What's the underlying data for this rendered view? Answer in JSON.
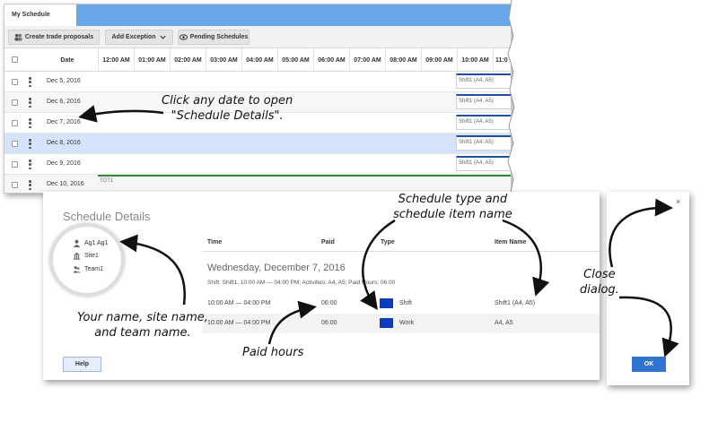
{
  "schedule": {
    "tab_label": "My Schedule",
    "toolbar": {
      "trade_label": "Create trade proposals",
      "exception_label": "Add Exception",
      "pending_label": "Pending Schedules"
    },
    "date_header": "Date",
    "hours": [
      "12:00 AM",
      "01:00 AM",
      "02:00 AM",
      "03:00 AM",
      "04:00 AM",
      "05:00 AM",
      "06:00 AM",
      "07:00 AM",
      "08:00 AM",
      "09:00 AM",
      "10:00 AM",
      "11:0"
    ],
    "rows": [
      {
        "date": "Dec 5, 2016",
        "shift": "Shift1 (A4, A5)"
      },
      {
        "date": "Dec 6, 2016",
        "shift": "Shift1 (A4, A5)"
      },
      {
        "date": "Dec 7, 2016",
        "shift": "Shift1 (A4, A5)"
      },
      {
        "date": "Dec 8, 2016",
        "shift": "Shift1 (A4, A5)"
      },
      {
        "date": "Dec 9, 2016",
        "shift": "Shift1 (A4, A5)"
      },
      {
        "date": "Dec 10, 2016",
        "shift": "TOT1"
      }
    ]
  },
  "dialog": {
    "title": "Schedule Details",
    "agent": "Ag1 Ag1",
    "site": "Site1",
    "team": "Team1",
    "columns": {
      "time": "Time",
      "paid": "Paid",
      "type": "Type",
      "item": "Item Name"
    },
    "day_title": "Wednesday, December 7, 2016",
    "summary": "Shift: Shift1, 10:00 AM — 04:00 PM; Activities: A4, A5; Paid Hours: 06:00",
    "rows": [
      {
        "time": "10:00 AM — 04:00 PM",
        "paid": "06:00",
        "type": "Shift",
        "item": "Shift1 (A4, A5)"
      },
      {
        "time": "10:00 AM — 04:00 PM",
        "paid": "06:00",
        "type": "Work",
        "item": "A4, A5"
      }
    ],
    "help_label": "Help",
    "ok_label": "OK",
    "close_glyph": "×",
    "swatch_color": "#0d3dbf"
  },
  "annotations": {
    "click_date_1": "Click any date to open",
    "click_date_2": "\"Schedule Details\".",
    "schedule_type_1": "Schedule type and",
    "schedule_type_2": "schedule item name",
    "name_1": "Your name, site name,",
    "name_2": "and team name.",
    "paid_hours": "Paid hours",
    "close_1": "Close",
    "close_2": "dialog."
  }
}
